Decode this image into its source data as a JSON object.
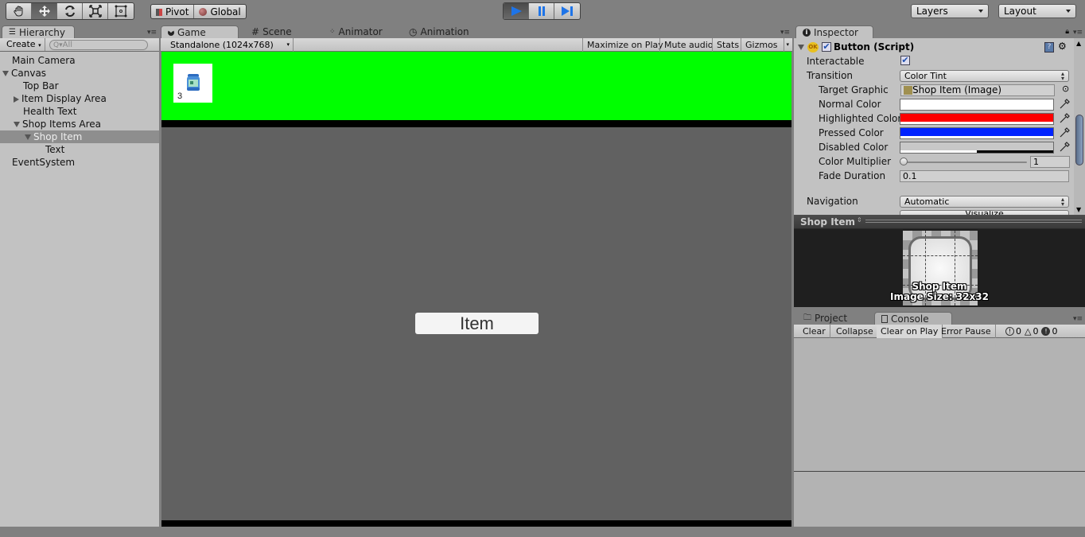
{
  "toolbar": {
    "tools": [
      "hand-tool",
      "move-tool",
      "rotate-tool",
      "scale-tool",
      "rect-tool"
    ],
    "active_tool": "move-tool",
    "pivot_label": "Pivot",
    "global_label": "Global",
    "play_controls": [
      "play",
      "pause",
      "step"
    ],
    "play_active": true,
    "layers_label": "Layers",
    "layout_label": "Layout"
  },
  "hierarchy": {
    "tab_label": "Hierarchy",
    "create_label": "Create",
    "search_placeholder": "All",
    "items": [
      {
        "label": "Main Camera",
        "depth": 0,
        "fold": "none",
        "selected": false
      },
      {
        "label": "Canvas",
        "depth": 0,
        "fold": "open",
        "selected": false
      },
      {
        "label": "Top Bar",
        "depth": 1,
        "fold": "none",
        "selected": false
      },
      {
        "label": "Item Display Area",
        "depth": 1,
        "fold": "closed",
        "selected": false
      },
      {
        "label": "Health Text",
        "depth": 1,
        "fold": "none",
        "selected": false
      },
      {
        "label": "Shop Items Area",
        "depth": 1,
        "fold": "open",
        "selected": false
      },
      {
        "label": "Shop Item",
        "depth": 2,
        "fold": "open",
        "selected": true
      },
      {
        "label": "Text",
        "depth": 3,
        "fold": "none",
        "selected": false
      },
      {
        "label": "EventSystem",
        "depth": 0,
        "fold": "none",
        "selected": false
      }
    ]
  },
  "center_tabs": [
    {
      "label": "Game",
      "icon": "pacman-icon",
      "active": true
    },
    {
      "label": "Scene",
      "icon": "hash-icon",
      "active": false
    },
    {
      "label": "Animator",
      "icon": "animator-icon",
      "active": false
    },
    {
      "label": "Animation",
      "icon": "clock-icon",
      "active": false
    }
  ],
  "game": {
    "resolution": "Standalone (1024x768)",
    "maximize_on_play": "Maximize on Play",
    "mute_audio": "Mute audio",
    "stats": "Stats",
    "gizmos": "Gizmos",
    "top_bar_color": "#00ff00",
    "item_slot_count": "3",
    "shop_item_button_label": "Item"
  },
  "inspector": {
    "tab_label": "Inspector",
    "component_title": "Button (Script)",
    "component_enabled": true,
    "fields": {
      "interactable_label": "Interactable",
      "interactable_value": true,
      "transition_label": "Transition",
      "transition_value": "Color Tint",
      "target_graphic_label": "Target Graphic",
      "target_graphic_value": "Shop Item (Image)",
      "normal_color_label": "Normal Color",
      "normal_color": "#ffffff",
      "highlighted_color_label": "Highlighted Color",
      "highlighted_color": "#ff0000",
      "pressed_color_label": "Pressed Color",
      "pressed_color": "#0022ff",
      "disabled_color_label": "Disabled Color",
      "disabled_color": "#c8c8c8",
      "color_multiplier_label": "Color Multiplier",
      "color_multiplier_value": "1",
      "fade_duration_label": "Fade Duration",
      "fade_duration_value": "0.1",
      "navigation_label": "Navigation",
      "navigation_value": "Automatic",
      "visualize_label": "Visualize"
    }
  },
  "preview": {
    "title": "Shop Item",
    "image_name": "Shop Item",
    "image_size": "Image Size: 32x32"
  },
  "console": {
    "tabs": [
      {
        "label": "Project",
        "icon": "folder-icon",
        "active": false
      },
      {
        "label": "Console",
        "icon": "console-icon",
        "active": true
      }
    ],
    "buttons": [
      "Clear",
      "Collapse",
      "Clear on Play",
      "Error Pause"
    ],
    "info_count": "0",
    "warning_count": "0",
    "error_count": "0"
  }
}
